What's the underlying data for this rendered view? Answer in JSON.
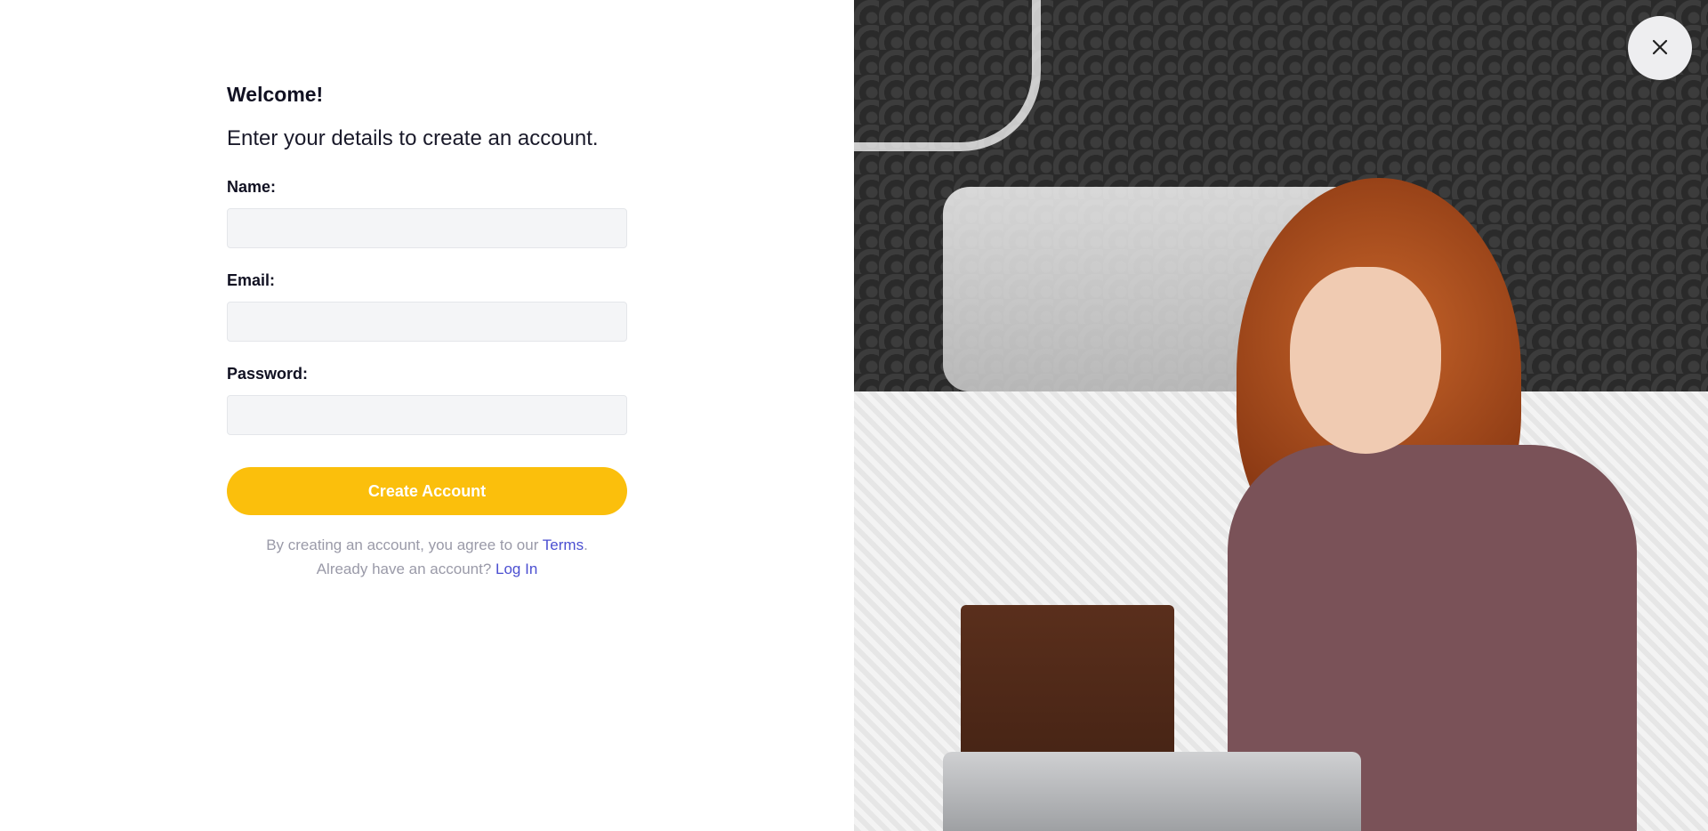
{
  "form": {
    "title": "Welcome!",
    "subtitle": "Enter your details to create an account.",
    "fields": [
      {
        "label": "Name:",
        "value": "",
        "placeholder": ""
      },
      {
        "label": "Email:",
        "value": "",
        "placeholder": ""
      },
      {
        "label": "Password:",
        "value": "",
        "placeholder": ""
      }
    ],
    "submit_label": "Create Account"
  },
  "legal": {
    "terms_prefix": "By creating an account, you agree to our ",
    "terms_link": "Terms",
    "terms_suffix": ".",
    "login_prefix": "Already have an account? ",
    "login_link": "Log In"
  },
  "close_icon": "close-icon",
  "colors": {
    "accent": "#fbbf0c",
    "link": "#4b4fd1",
    "input_bg": "#f4f5f7"
  }
}
